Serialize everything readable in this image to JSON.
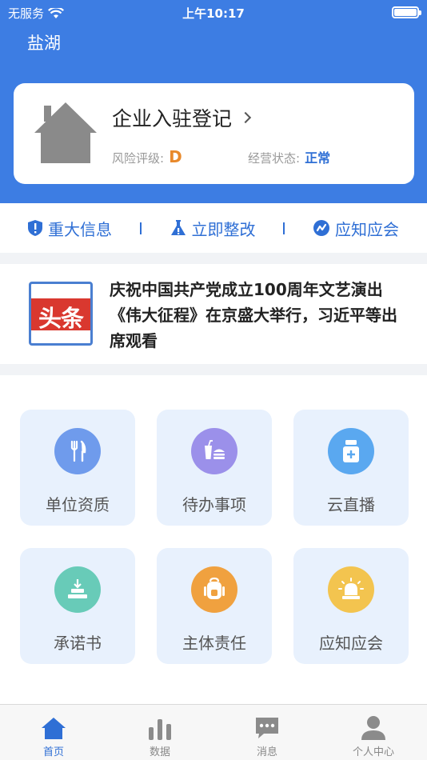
{
  "status_bar": {
    "carrier": "无服务",
    "time": "上午10:17"
  },
  "header": {
    "city": "盐湖"
  },
  "enterprise": {
    "title": "企业入驻登记",
    "risk_label": "风险评级:",
    "risk_value": "D",
    "status_label": "经营状态:",
    "status_value": "正常"
  },
  "quick_links": [
    {
      "label": "重大信息",
      "icon": "shield-icon"
    },
    {
      "label": "立即整改",
      "icon": "alert-flask-icon"
    },
    {
      "label": "应知应会",
      "icon": "link-icon"
    }
  ],
  "news": {
    "badge": "头条",
    "text": "庆祝中国共产党成立100周年文艺演出《伟大征程》在京盛大举行，习近平等出席观看"
  },
  "grid": [
    {
      "label": "单位资质",
      "icon": "fork-knife-icon",
      "color": "#6f9bec"
    },
    {
      "label": "待办事项",
      "icon": "food-drink-icon",
      "color": "#9b90ea"
    },
    {
      "label": "云直播",
      "icon": "medicine-bottle-icon",
      "color": "#5aa8f0"
    },
    {
      "label": "承诺书",
      "icon": "stamp-icon",
      "color": "#68cbb8"
    },
    {
      "label": "主体责任",
      "icon": "backpack-icon",
      "color": "#f0a13f"
    },
    {
      "label": "应知应会",
      "icon": "alarm-light-icon",
      "color": "#f3c44f"
    }
  ],
  "tabs": [
    {
      "label": "首页",
      "icon": "home-icon",
      "active": true
    },
    {
      "label": "数据",
      "icon": "bar-chart-icon",
      "active": false
    },
    {
      "label": "消息",
      "icon": "message-icon",
      "active": false
    },
    {
      "label": "个人中心",
      "icon": "user-icon",
      "active": false
    }
  ],
  "colors": {
    "primary": "#3d7de3",
    "accent": "#2f6fd5",
    "risk": "#e8892b",
    "tile_bg": "#e8f1fd"
  }
}
